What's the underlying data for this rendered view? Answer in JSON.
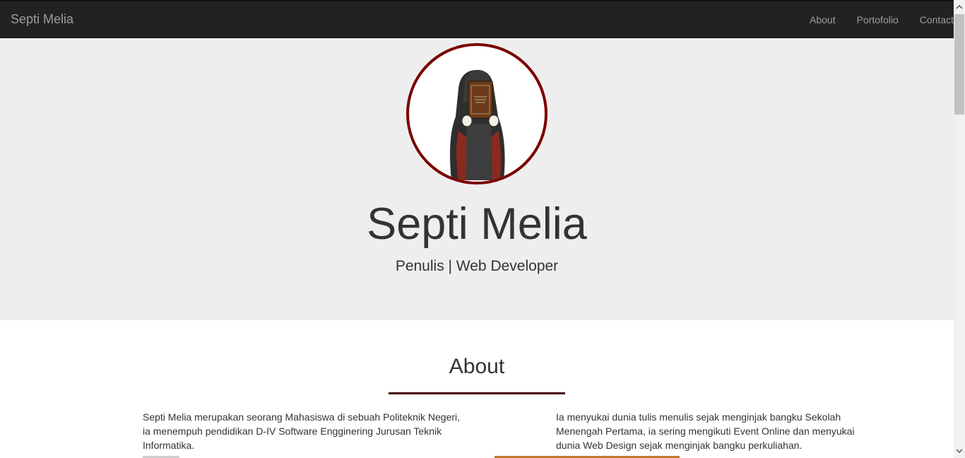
{
  "navbar": {
    "brand": "Septi Melia",
    "links": [
      "About",
      "Portofolio",
      "Contact"
    ]
  },
  "hero": {
    "name": "Septi Melia",
    "tagline": "Penulis | Web Developer",
    "avatar_icon": "hijab-girl-holding-book-illustration"
  },
  "about": {
    "title": "About",
    "left_text": "Septi Melia merupakan seorang Mahasiswa di sebuah Politeknik Negeri, ia menempuh pendidikan D-IV Software Engginering Jurusan Teknik Informatika.",
    "right_text": "Ia menyukai dunia tulis menulis sejak menginjak bangku Sekolah Menengah Pertama, ia sering mengikuti Event Online dan menyukai dunia Web Design sejak menginjak bangku perkuliahan."
  },
  "colors": {
    "navbar_bg": "#222222",
    "hero_bg": "#eeeeee",
    "accent": "#7a0000"
  }
}
